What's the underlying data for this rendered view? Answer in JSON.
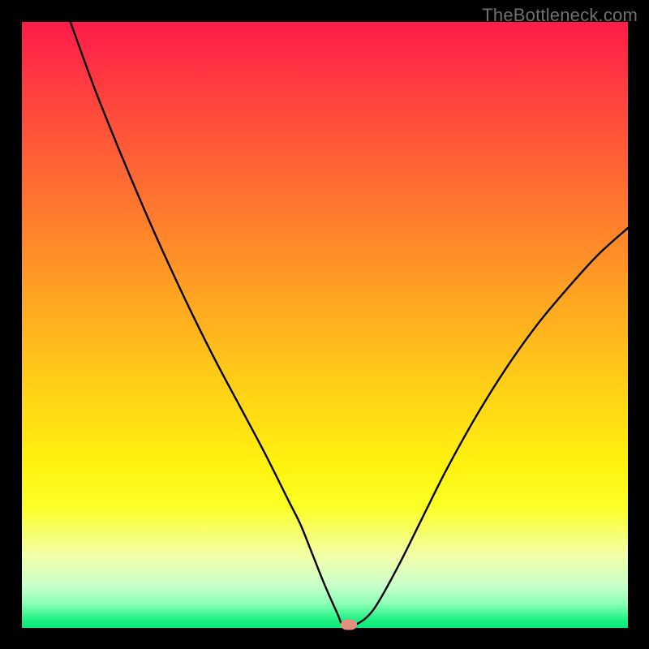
{
  "watermark": "TheBottleneck.com",
  "chart_data": {
    "type": "line",
    "title": "",
    "xlabel": "",
    "ylabel": "",
    "xlim": [
      0,
      100
    ],
    "ylim": [
      0,
      100
    ],
    "grid": false,
    "series": [
      {
        "name": "curve",
        "x": [
          8,
          12,
          16,
          20,
          24,
          28,
          32,
          36,
          40,
          44,
          46,
          48,
          50,
          52,
          53,
          55,
          58,
          62,
          66,
          70,
          75,
          80,
          85,
          90,
          95,
          100
        ],
        "values": [
          100,
          89,
          79,
          69.5,
          60.5,
          52,
          44,
          36.5,
          29,
          21,
          17,
          12,
          7,
          2.5,
          0.5,
          0.5,
          3,
          10,
          18,
          26,
          35,
          43,
          50,
          56,
          61.5,
          66
        ]
      }
    ],
    "marker": {
      "x": 54,
      "y": 0.5
    },
    "background_gradient": {
      "top": "#ff1b4b",
      "mid": "#ffd516",
      "bottom": "#09e879"
    },
    "curve_color": "#000000",
    "marker_color": "#e28f7e"
  }
}
